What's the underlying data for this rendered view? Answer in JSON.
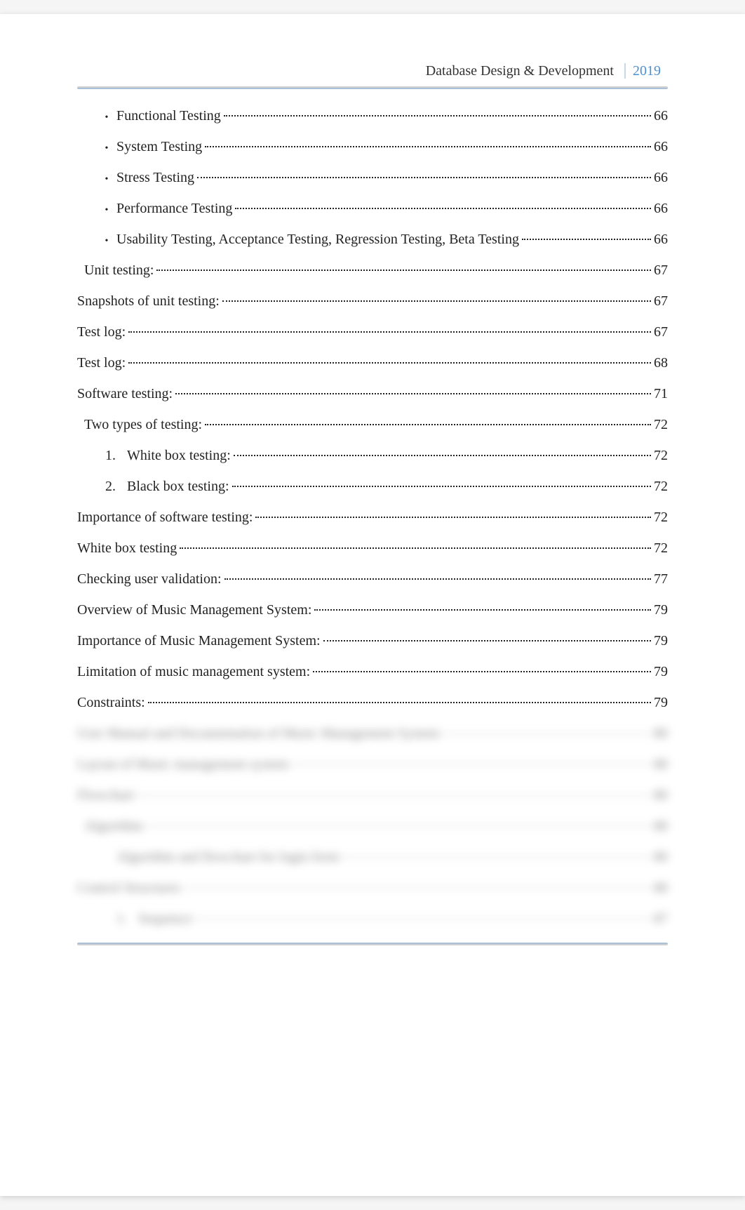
{
  "header": {
    "title": "Database Design & Development",
    "year": "2019"
  },
  "toc": [
    {
      "bullet": true,
      "indent": 1,
      "text": "Functional Testing",
      "page": "66"
    },
    {
      "bullet": true,
      "indent": 1,
      "text": "System Testing",
      "page": "66"
    },
    {
      "bullet": true,
      "indent": 1,
      "text": "Stress Testing",
      "page": "66"
    },
    {
      "bullet": true,
      "indent": 1,
      "text": "Performance Testing",
      "page": "66"
    },
    {
      "bullet": true,
      "indent": 1,
      "text": "Usability Testing, Acceptance Testing, Regression Testing, Beta Testing",
      "page": "66"
    },
    {
      "bullet": false,
      "indent": 2,
      "text": "Unit testing:",
      "page": "67"
    },
    {
      "bullet": false,
      "indent": 0,
      "text": "Snapshots of unit testing:",
      "page": "67"
    },
    {
      "bullet": false,
      "indent": 0,
      "text": "Test log:",
      "page": "67"
    },
    {
      "bullet": false,
      "indent": 0,
      "text": "Test log:",
      "page": "68"
    },
    {
      "bullet": false,
      "indent": 0,
      "text": "Software testing:",
      "page": "71"
    },
    {
      "bullet": false,
      "indent": 2,
      "text": "Two types of testing:",
      "page": "72"
    },
    {
      "bullet": false,
      "indent": 3,
      "num": "1.",
      "text": "White box testing:",
      "page": "72"
    },
    {
      "bullet": false,
      "indent": 3,
      "num": "2.",
      "text": "Black box testing:",
      "page": "72"
    },
    {
      "bullet": false,
      "indent": 0,
      "text": "Importance of software testing:",
      "page": "72"
    },
    {
      "bullet": false,
      "indent": 0,
      "text": "White box testing",
      "page": "72"
    },
    {
      "bullet": false,
      "indent": 0,
      "text": "Checking user validation:",
      "page": "77"
    },
    {
      "bullet": false,
      "indent": 0,
      "text": "Overview of Music Management System:",
      "page": "79"
    },
    {
      "bullet": false,
      "indent": 0,
      "text": "Importance of Music Management System:",
      "page": "79"
    },
    {
      "bullet": false,
      "indent": 0,
      "text": "Limitation of music management system:",
      "page": "79"
    },
    {
      "bullet": false,
      "indent": 0,
      "text": "Constraints:",
      "page": "79"
    },
    {
      "bullet": false,
      "indent": 0,
      "text": "User Manual and Documentation of Music Management System",
      "page": "80",
      "blur": true
    },
    {
      "bullet": false,
      "indent": 0,
      "text": "Layout of Music management system",
      "page": "80",
      "blur": true
    },
    {
      "bullet": false,
      "indent": 0,
      "text": "Flowchart",
      "page": "80",
      "blur": true
    },
    {
      "bullet": false,
      "indent": 2,
      "text": "Algorithm",
      "page": "80",
      "blur": true
    },
    {
      "bullet": false,
      "indent": 4,
      "text": "Algorithm and flowchart for login form",
      "page": "80",
      "blur": true
    },
    {
      "bullet": false,
      "indent": 0,
      "text": "Control Structures",
      "page": "80",
      "blur": true
    },
    {
      "bullet": false,
      "indent": 4,
      "num": "1.",
      "text": "Sequence",
      "page": "87",
      "blur": true
    }
  ]
}
